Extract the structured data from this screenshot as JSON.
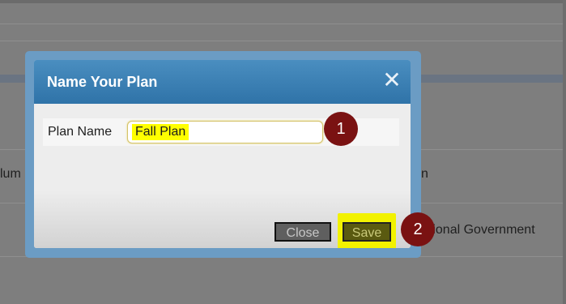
{
  "background": {
    "left_fragment": "lum",
    "right_fragment_top": "n",
    "right_fragment_row": "ational Government"
  },
  "dialog": {
    "title": "Name Your Plan",
    "close_icon": "close-x-icon",
    "field_label": "Plan Name",
    "field_value": "Fall Plan",
    "buttons": {
      "close_label": "Close",
      "save_label": "Save"
    }
  },
  "annotations": {
    "step_1": "1",
    "step_2": "2"
  },
  "colors": {
    "header": "#2f73a8",
    "highlight": "#ffff00",
    "badge": "#7a1212"
  }
}
